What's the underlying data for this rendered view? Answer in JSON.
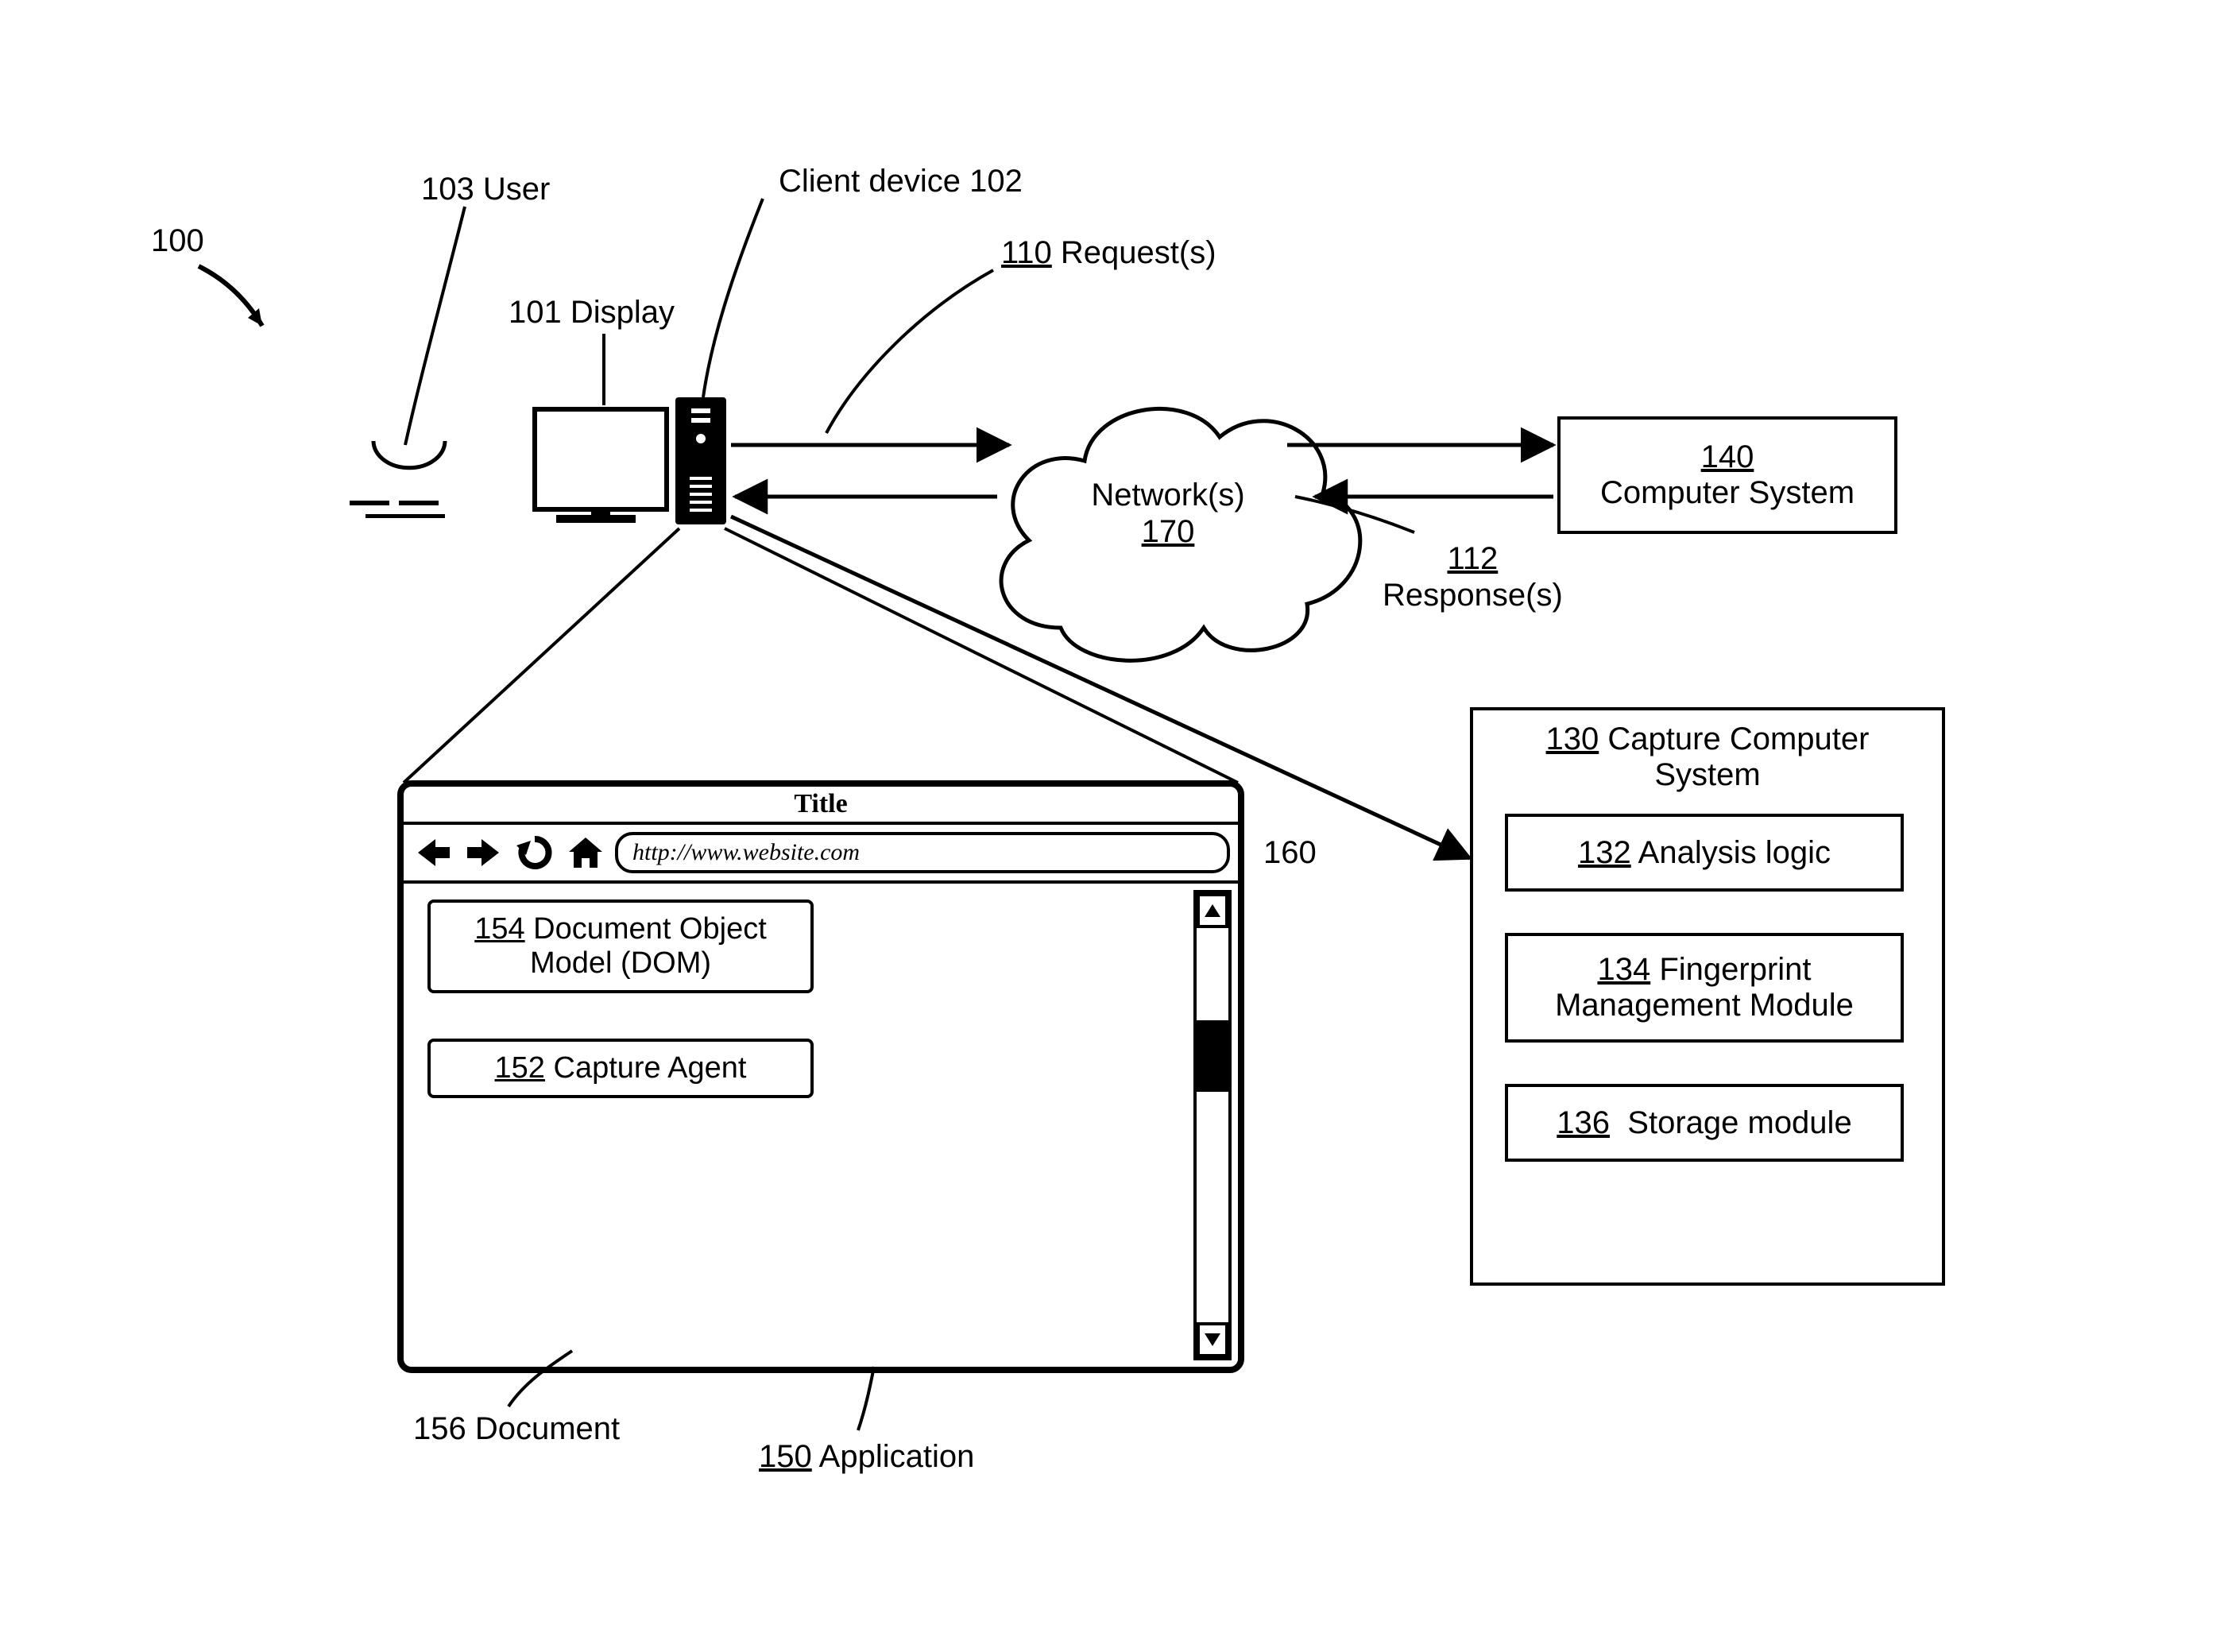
{
  "figure_ref": "100",
  "labels": {
    "user": {
      "num": "103",
      "text": "User"
    },
    "display": {
      "num": "101",
      "text": "Display"
    },
    "client_device": {
      "num": "",
      "text": "Client device 102"
    },
    "requests": {
      "num": "110",
      "text": "Request(s)"
    },
    "responses": {
      "num": "112",
      "text": "Response(s)"
    },
    "networks": {
      "num": "170",
      "text": "Network(s)"
    },
    "arrow160": "160",
    "application": {
      "num": "150",
      "text": "Application"
    },
    "document": {
      "num": "",
      "text": "156 Document"
    }
  },
  "computer_system": {
    "num": "140",
    "text": "Computer System"
  },
  "capture_system": {
    "num": "130",
    "title": "Capture Computer System",
    "items": [
      {
        "num": "132",
        "text": "Analysis logic"
      },
      {
        "num": "134",
        "text": "Fingerprint Management Module"
      },
      {
        "num": "136",
        "text": "Storage module"
      }
    ]
  },
  "browser": {
    "title": "Title",
    "url": "http://www.website.com",
    "dom": {
      "num": "154",
      "text": "Document Object Model (DOM)"
    },
    "agent": {
      "num": "152",
      "text": "Capture Agent"
    }
  }
}
